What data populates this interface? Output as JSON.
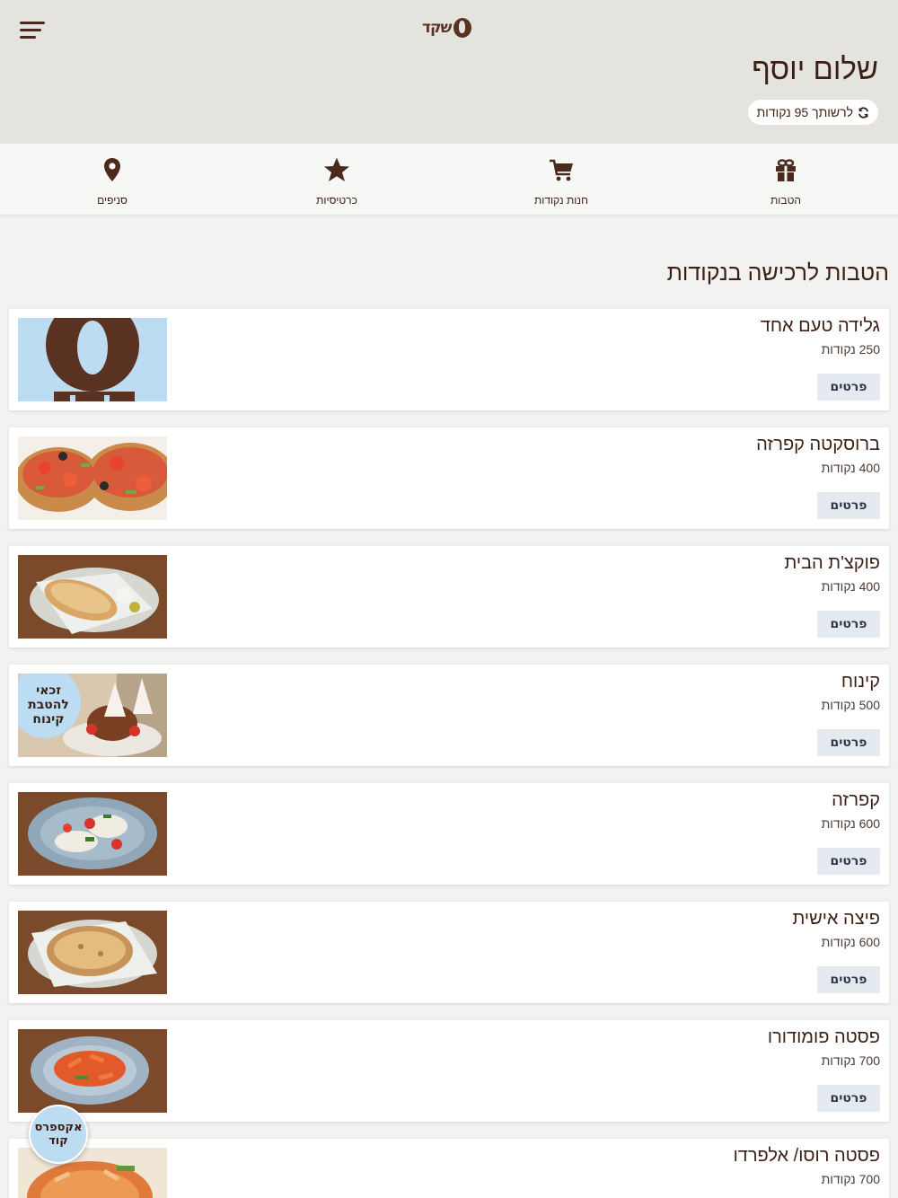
{
  "header": {
    "logo_text": "שקד",
    "greeting": "שלום יוסף",
    "points_status": "לרשותך 95 נקודות"
  },
  "nav": [
    {
      "label": "הטבות",
      "icon": "gift-icon"
    },
    {
      "label": "חנות נקודות",
      "icon": "cart-icon"
    },
    {
      "label": "כרטיסיות",
      "icon": "star-icon"
    },
    {
      "label": "סניפים",
      "icon": "map-pin-icon"
    }
  ],
  "section_title": "הטבות לרכישה בנקודות",
  "details_label": "פרטים",
  "items": [
    {
      "title": "גלידה טעם אחד",
      "points": "250 נקודות",
      "image": "logo-image"
    },
    {
      "title": "ברוסקטה קפרזה",
      "points": "400 נקודות",
      "image": "bruschetta-image"
    },
    {
      "title": "פוקצ'ת הבית",
      "points": "400 נקודות",
      "image": "focaccia-image"
    },
    {
      "title": "קינוח",
      "points": "500 נקודות",
      "image": "dessert-image",
      "image_badge": [
        "זכאי",
        "להטבת",
        "קינוח"
      ]
    },
    {
      "title": "קפרזה",
      "points": "600 נקודות",
      "image": "caprese-image"
    },
    {
      "title": "פיצה אישית",
      "points": "600 נקודות",
      "image": "pizza-image"
    },
    {
      "title": "פסטה פומודורו",
      "points": "700 נקודות",
      "image": "pasta-image"
    },
    {
      "title": "פסטה רוסו/ אלפרדו",
      "points": "700 נקודות",
      "image": "pasta-rosso-image"
    }
  ],
  "express_button": {
    "line1": "אקספרס",
    "line2": "קוד"
  },
  "colors": {
    "header_bg": "#e4e3dd",
    "brand_brown": "#4a2a1c",
    "button_bg": "#e5eaf1",
    "express_bg": "#bcdcf2"
  }
}
